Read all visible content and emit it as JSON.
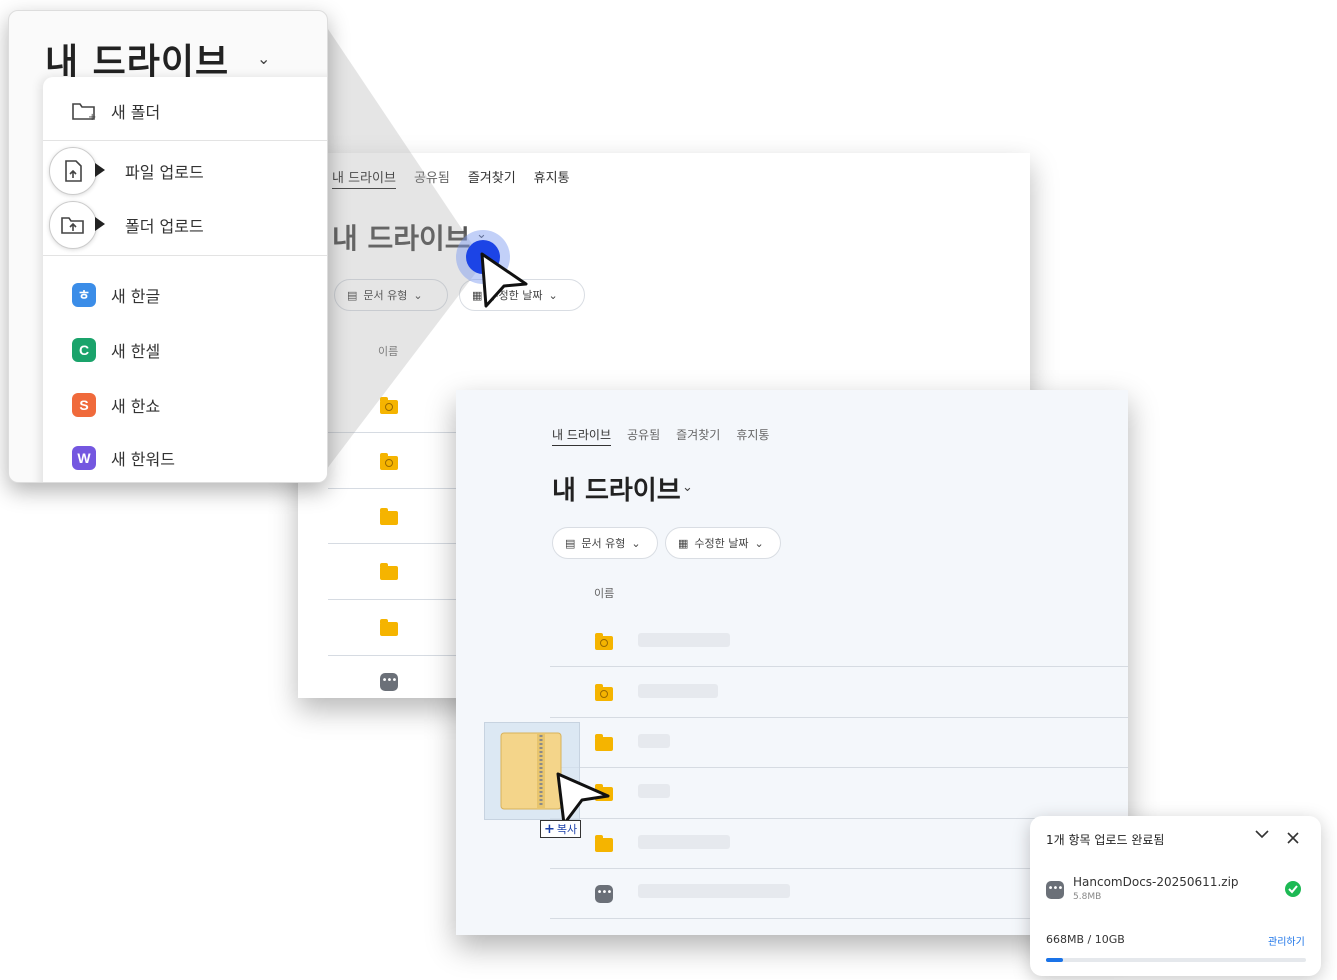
{
  "drive": {
    "title": "내 드라이브",
    "chevron": "⌄",
    "tabs": [
      "내 드라이브",
      "공유됨",
      "즐겨찾기",
      "휴지통"
    ],
    "filters": {
      "doc_type": "문서 유형",
      "modified_date": "수정한 날짜"
    },
    "column_name": "이름"
  },
  "menu": {
    "new_folder": "새 폴더",
    "file_upload": "파일 업로드",
    "folder_upload": "폴더 업로드",
    "apps": [
      {
        "label": "새 한글",
        "icon": "hangul-icon",
        "letter": "ㅎ",
        "color": "#3b8de8"
      },
      {
        "label": "새 한셀",
        "icon": "hancell-icon",
        "letter": "C",
        "color": "#1aa36b"
      },
      {
        "label": "새 한쇼",
        "icon": "hanshow-icon",
        "letter": "S",
        "color": "#f06a3b"
      },
      {
        "label": "새 한워드",
        "icon": "hanword-icon",
        "letter": "W",
        "color": "#7457e0"
      }
    ]
  },
  "drag": {
    "copy_label": "복사",
    "plus": "+"
  },
  "upload_toast": {
    "title": "1개 항목 업로드 완료됨",
    "file_name": "HancomDocs-20250611.zip",
    "file_size": "5.8MB",
    "storage": "668MB / 10GB",
    "manage_label": "관리하기",
    "storage_used_fraction": 0.067,
    "accent": "#1a73e8",
    "success_color": "#1db954"
  }
}
